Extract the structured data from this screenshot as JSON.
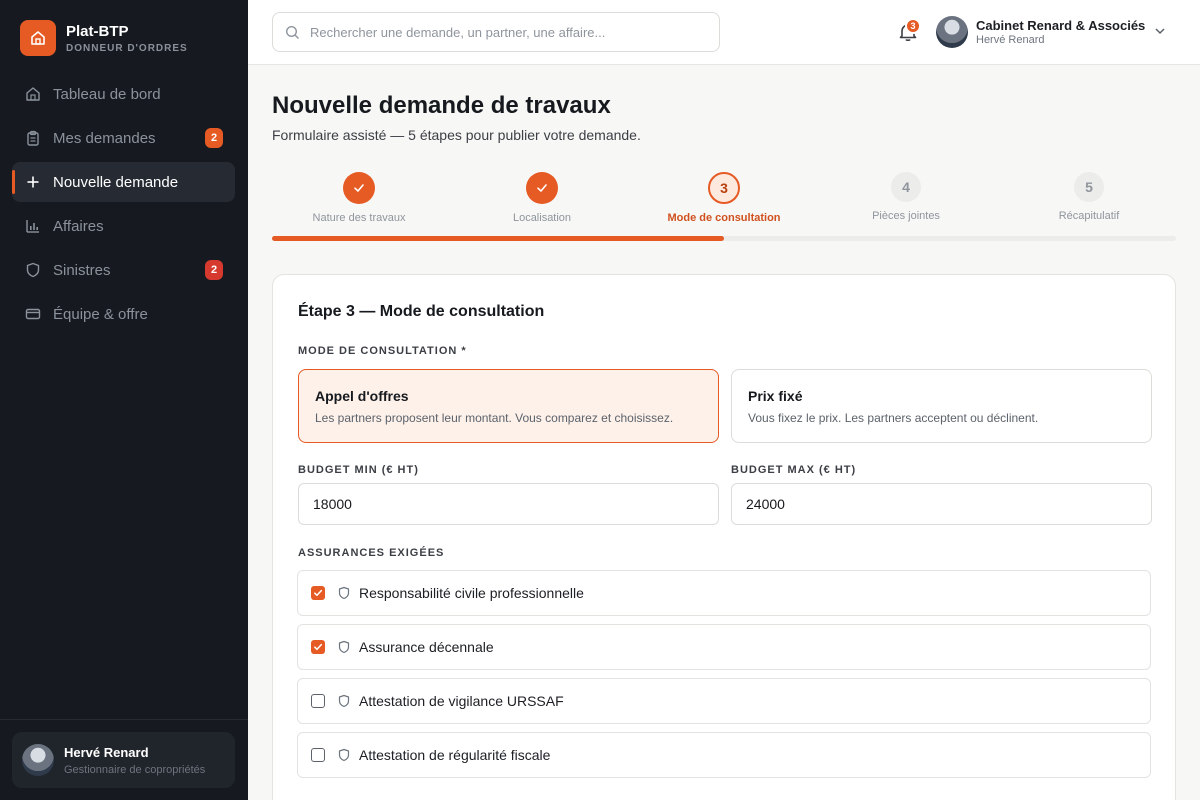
{
  "brand": {
    "name": "Plat-BTP",
    "subtitle": "DONNEUR D'ORDRES",
    "accent": "#e65a24"
  },
  "sidebar": {
    "items": [
      {
        "label": "Tableau de bord",
        "icon": "home-icon",
        "active": false,
        "badge": ""
      },
      {
        "label": "Mes demandes",
        "icon": "clipboard-icon",
        "active": false,
        "badge": "2",
        "badge_color": "#e65a24"
      },
      {
        "label": "Nouvelle demande",
        "icon": "plus-icon",
        "active": true,
        "badge": ""
      },
      {
        "label": "Affaires",
        "icon": "bar-chart-icon",
        "active": false,
        "badge": ""
      },
      {
        "label": "Sinistres",
        "icon": "shield-icon",
        "active": false,
        "badge": "2",
        "badge_color": "#d63a2f"
      },
      {
        "label": "Équipe & offre",
        "icon": "card-icon",
        "active": false,
        "badge": ""
      }
    ],
    "user": {
      "name": "Hervé Renard",
      "role": "Gestionnaire de copropriétés"
    }
  },
  "header": {
    "search_placeholder": "Rechercher une demande, un partner, une affaire...",
    "notifications_count": "3",
    "company": "Cabinet Renard & Associés",
    "user_name": "Hervé Renard"
  },
  "main": {
    "title": "Nouvelle demande de travaux",
    "subtitle": "Formulaire assisté — 5 étapes pour publier votre demande.",
    "progress": 0.5,
    "steps": [
      {
        "number": "1",
        "label": "Nature des travaux",
        "state": "done"
      },
      {
        "number": "2",
        "label": "Localisation",
        "state": "done"
      },
      {
        "number": "3",
        "label": "Mode de consultation",
        "state": "current"
      },
      {
        "number": "4",
        "label": "Pièces jointes",
        "state": "todo"
      },
      {
        "number": "5",
        "label": "Récapitulatif",
        "state": "todo"
      }
    ],
    "form": {
      "title": "Étape 3 — Mode de consultation",
      "mode_label": "MODE DE CONSULTATION *",
      "modes": [
        {
          "title": "Appel d'offres",
          "description": "Les partners proposent leur montant. Vous comparez et choisissez.",
          "selected": true
        },
        {
          "title": "Prix fixé",
          "description": "Vous fixez le prix. Les partners acceptent ou déclinent.",
          "selected": false
        }
      ],
      "budget_min_label": "BUDGET MIN (€ HT)",
      "budget_min_value": "18000",
      "budget_max_label": "BUDGET MAX (€ HT)",
      "budget_max_value": "24000",
      "insurance_label": "ASSURANCES EXIGÉES",
      "insurances": [
        {
          "label": "Responsabilité civile professionnelle",
          "checked": true
        },
        {
          "label": "Assurance décennale",
          "checked": true
        },
        {
          "label": "Attestation de vigilance URSSAF",
          "checked": false
        },
        {
          "label": "Attestation de régularité fiscale",
          "checked": false
        }
      ]
    }
  }
}
